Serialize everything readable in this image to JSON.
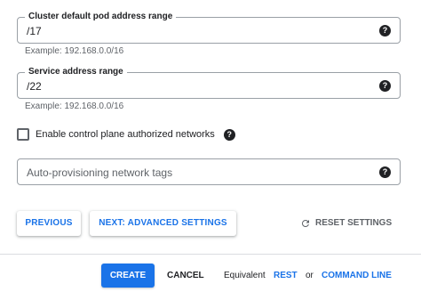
{
  "fields": {
    "pod_range": {
      "label": "Cluster default pod address range",
      "value": "/17",
      "hint": "Example: 192.168.0.0/16"
    },
    "service_range": {
      "label": "Service address range",
      "value": "/22",
      "hint": "Example: 192.168.0.0/16"
    },
    "network_tags": {
      "placeholder": "Auto-provisioning network tags"
    },
    "help_glyph": "?"
  },
  "checkbox": {
    "label": "Enable control plane authorized networks",
    "checked": false
  },
  "buttons": {
    "previous": "PREVIOUS",
    "next": "NEXT: ADVANCED SETTINGS",
    "reset": "RESET SETTINGS",
    "create": "CREATE",
    "cancel": "CANCEL"
  },
  "footer": {
    "equivalent": "Equivalent",
    "rest": "REST",
    "or": "or",
    "command_line": "COMMAND LINE"
  },
  "colors": {
    "accent": "#1a73e8",
    "text": "#202124",
    "muted": "#5f6368",
    "border": "#9aa0a6"
  }
}
